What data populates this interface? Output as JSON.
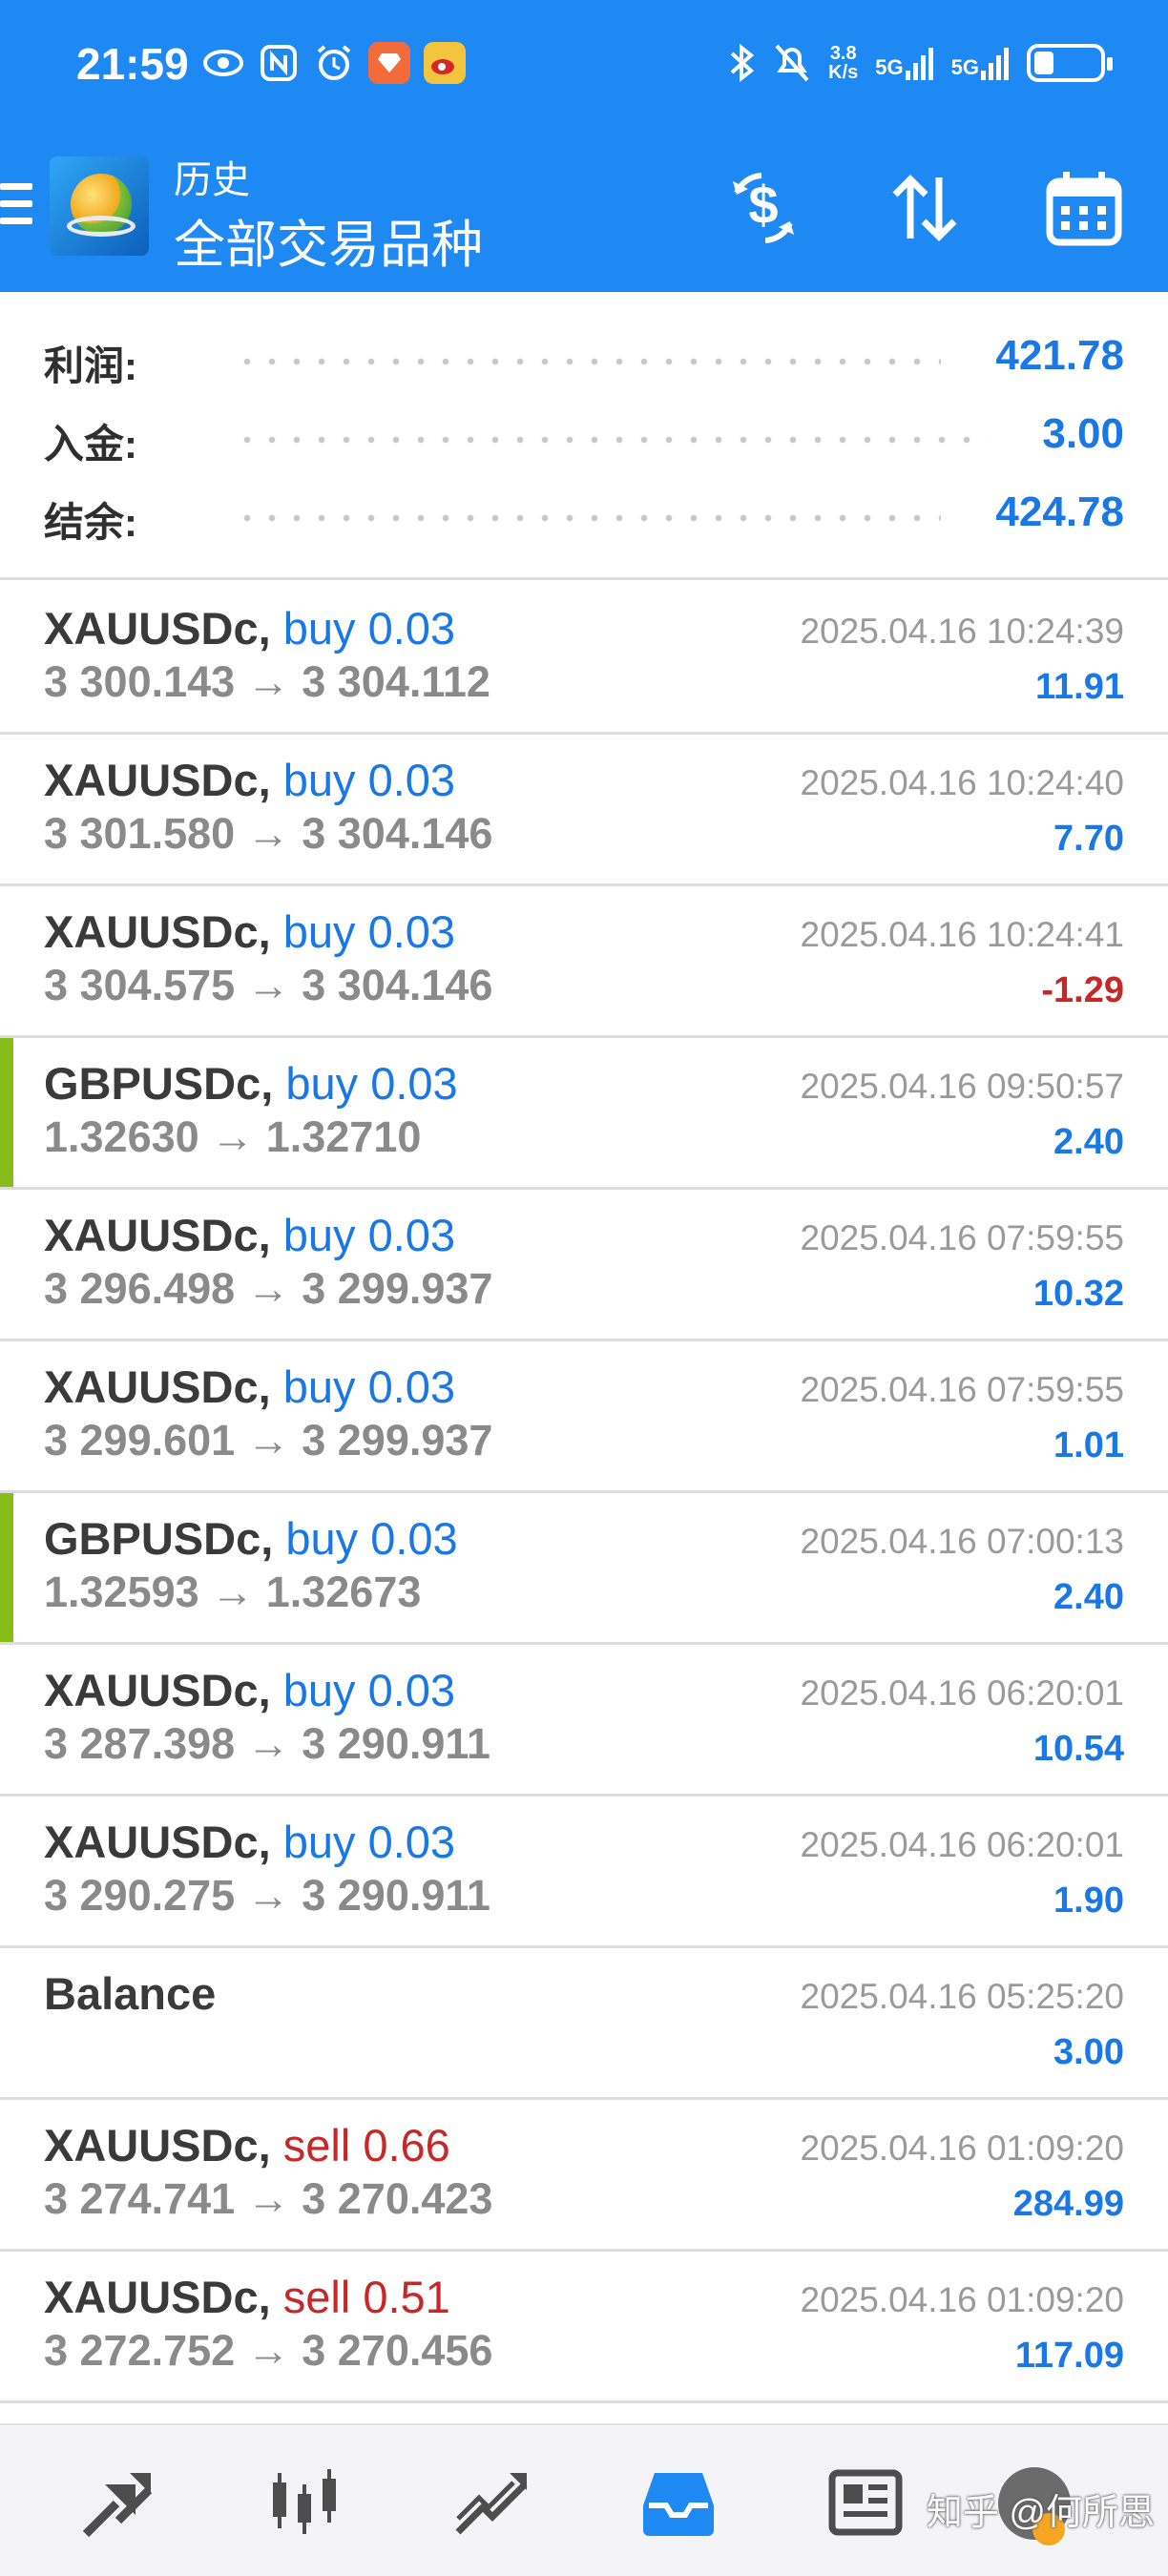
{
  "status_bar": {
    "time": "21:59",
    "net_speed_value": "3.8",
    "net_speed_unit": "K/s",
    "signal1": "5G",
    "signal2": "5G",
    "battery_level": 0.3,
    "left_icons": [
      "eye-icon",
      "nfc-icon",
      "alarm-icon",
      "app-badge-icon",
      "weibo-icon"
    ],
    "right_icons": [
      "bluetooth-icon",
      "mute-icon",
      "signal-icon",
      "battery-icon"
    ]
  },
  "header": {
    "subtitle": "历史",
    "title": "全部交易品种",
    "buttons": [
      "dollar-sync-icon",
      "sort-icon",
      "calendar-icon"
    ],
    "accent_color": "#1e88f3"
  },
  "summary": [
    {
      "label": "利润:",
      "value": "421.78"
    },
    {
      "label": "入金:",
      "value": "3.00"
    },
    {
      "label": "结余:",
      "value": "424.78"
    }
  ],
  "deals": [
    {
      "symbol": "XAUUSDc,",
      "type": "buy",
      "volume": "0.03",
      "open": "3 300.143",
      "arrow": "→",
      "close": "3 304.112",
      "time": "2025.04.16 10:24:39",
      "profit": "11.91",
      "marked": false,
      "negative": false
    },
    {
      "symbol": "XAUUSDc,",
      "type": "buy",
      "volume": "0.03",
      "open": "3 301.580",
      "arrow": "→",
      "close": "3 304.146",
      "time": "2025.04.16 10:24:40",
      "profit": "7.70",
      "marked": false,
      "negative": false
    },
    {
      "symbol": "XAUUSDc,",
      "type": "buy",
      "volume": "0.03",
      "open": "3 304.575",
      "arrow": "→",
      "close": "3 304.146",
      "time": "2025.04.16 10:24:41",
      "profit": "-1.29",
      "marked": false,
      "negative": true
    },
    {
      "symbol": "GBPUSDc,",
      "type": "buy",
      "volume": "0.03",
      "open": "1.32630",
      "arrow": "→",
      "close": "1.32710",
      "time": "2025.04.16 09:50:57",
      "profit": "2.40",
      "marked": true,
      "negative": false
    },
    {
      "symbol": "XAUUSDc,",
      "type": "buy",
      "volume": "0.03",
      "open": "3 296.498",
      "arrow": "→",
      "close": "3 299.937",
      "time": "2025.04.16 07:59:55",
      "profit": "10.32",
      "marked": false,
      "negative": false
    },
    {
      "symbol": "XAUUSDc,",
      "type": "buy",
      "volume": "0.03",
      "open": "3 299.601",
      "arrow": "→",
      "close": "3 299.937",
      "time": "2025.04.16 07:59:55",
      "profit": "1.01",
      "marked": false,
      "negative": false
    },
    {
      "symbol": "GBPUSDc,",
      "type": "buy",
      "volume": "0.03",
      "open": "1.32593",
      "arrow": "→",
      "close": "1.32673",
      "time": "2025.04.16 07:00:13",
      "profit": "2.40",
      "marked": true,
      "negative": false
    },
    {
      "symbol": "XAUUSDc,",
      "type": "buy",
      "volume": "0.03",
      "open": "3 287.398",
      "arrow": "→",
      "close": "3 290.911",
      "time": "2025.04.16 06:20:01",
      "profit": "10.54",
      "marked": false,
      "negative": false
    },
    {
      "symbol": "XAUUSDc,",
      "type": "buy",
      "volume": "0.03",
      "open": "3 290.275",
      "arrow": "→",
      "close": "3 290.911",
      "time": "2025.04.16 06:20:01",
      "profit": "1.90",
      "marked": false,
      "negative": false
    },
    {
      "symbol": "Balance",
      "type": "",
      "volume": "",
      "open": "",
      "arrow": "",
      "close": "",
      "time": "2025.04.16 05:25:20",
      "profit": "3.00",
      "marked": false,
      "negative": false
    },
    {
      "symbol": "XAUUSDc,",
      "type": "sell",
      "volume": "0.66",
      "open": "3 274.741",
      "arrow": "→",
      "close": "3 270.423",
      "time": "2025.04.16 01:09:20",
      "profit": "284.99",
      "marked": false,
      "negative": false
    },
    {
      "symbol": "XAUUSDc,",
      "type": "sell",
      "volume": "0.51",
      "open": "3 272.752",
      "arrow": "→",
      "close": "3 270.456",
      "time": "2025.04.16 01:09:20",
      "profit": "117.09",
      "marked": false,
      "negative": false
    }
  ],
  "bottom_nav": {
    "items": [
      "quotes-icon",
      "chart-icon",
      "trade-icon",
      "history-icon",
      "news-icon",
      "messages-icon"
    ],
    "active_index": 3
  },
  "watermark": "知乎 @何所思"
}
